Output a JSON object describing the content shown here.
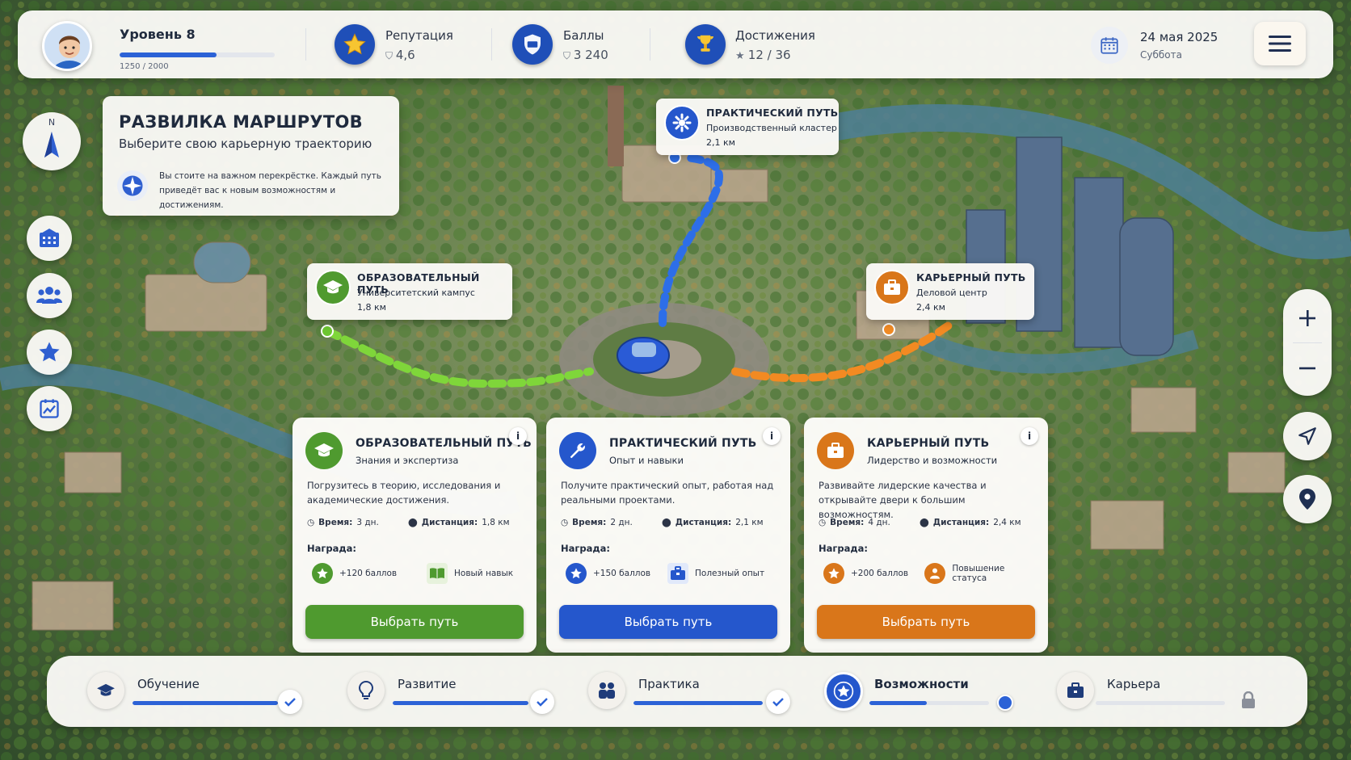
{
  "player": {
    "level_label": "Уровень 8",
    "xp_text": "1250 / 2000",
    "xp_progress": 0.625
  },
  "stats": [
    {
      "label": "Репутация",
      "value": "4,6",
      "icon": "star-icon"
    },
    {
      "label": "Баллы",
      "value": "3 240",
      "icon": "shield-icon"
    },
    {
      "label": "Достижения",
      "value": "12 / 36",
      "icon": "trophy-icon"
    }
  ],
  "date": {
    "main": "24 мая 2025",
    "sub": "Суббота"
  },
  "compass": {
    "label": "N"
  },
  "info": {
    "title": "РАЗВИЛКА МАРШРУТОВ",
    "subtitle": "Выберите свою карьерную траекторию",
    "text": "Вы стоите на важном перекрёстке. Каждый путь приведёт вас к новым возможностям и достижениям."
  },
  "callouts": {
    "practice": {
      "title": "ПРАКТИЧЕСКИЙ ПУТЬ",
      "sub": "Производственный кластер",
      "dist": "2,1 км"
    },
    "education": {
      "title": "ОБРАЗОВАТЕЛЬНЫЙ ПУТЬ",
      "sub": "Университетский кампус",
      "dist": "1,8 км"
    },
    "career": {
      "title": "КАРЬЕРНЫЙ ПУТЬ",
      "sub": "Деловой центр",
      "dist": "2,4 км"
    }
  },
  "cards": [
    {
      "title": "ОБРАЗОВАТЕЛЬНЫЙ ПУТЬ",
      "sub": "Знания и экспертиза",
      "desc": "Погрузитесь в теорию, исследования и академические достижения.",
      "time_label": "Время:",
      "time_value": "3 дн.",
      "dist_label": "Дистанция:",
      "dist_value": "1,8 км",
      "reward_label": "Награда:",
      "reward1": "+120 баллов",
      "reward2": "Новый навык",
      "button": "Выбрать путь",
      "color": "#4f9a2f"
    },
    {
      "title": "ПРАКТИЧЕСКИЙ ПУТЬ",
      "sub": "Опыт и навыки",
      "desc": "Получите практический опыт, работая над реальными проектами.",
      "time_label": "Время:",
      "time_value": "2 дн.",
      "dist_label": "Дистанция:",
      "dist_value": "2,1 км",
      "reward_label": "Награда:",
      "reward1": "+150 баллов",
      "reward2": "Полезный опыт",
      "button": "Выбрать путь",
      "color": "#2557cc"
    },
    {
      "title": "КАРЬЕРНЫЙ ПУТЬ",
      "sub": "Лидерство и возможности",
      "desc": "Развивайте лидерские качества и открывайте двери к большим возможностям.",
      "time_label": "Время:",
      "time_value": "4 дн.",
      "dist_label": "Дистанция:",
      "dist_value": "2,4 км",
      "reward_label": "Награда:",
      "reward1": "+200 баллов",
      "reward2": "Повышение статуса",
      "button": "Выбрать путь",
      "color": "#d9761a"
    }
  ],
  "steps": [
    {
      "label": "Обучение",
      "progress": 1.0,
      "status": "done"
    },
    {
      "label": "Развитие",
      "progress": 1.0,
      "status": "done"
    },
    {
      "label": "Практика",
      "progress": 1.0,
      "status": "done"
    },
    {
      "label": "Возможности",
      "progress": 0.48,
      "status": "current"
    },
    {
      "label": "Карьера",
      "progress": 0,
      "status": "locked"
    }
  ]
}
